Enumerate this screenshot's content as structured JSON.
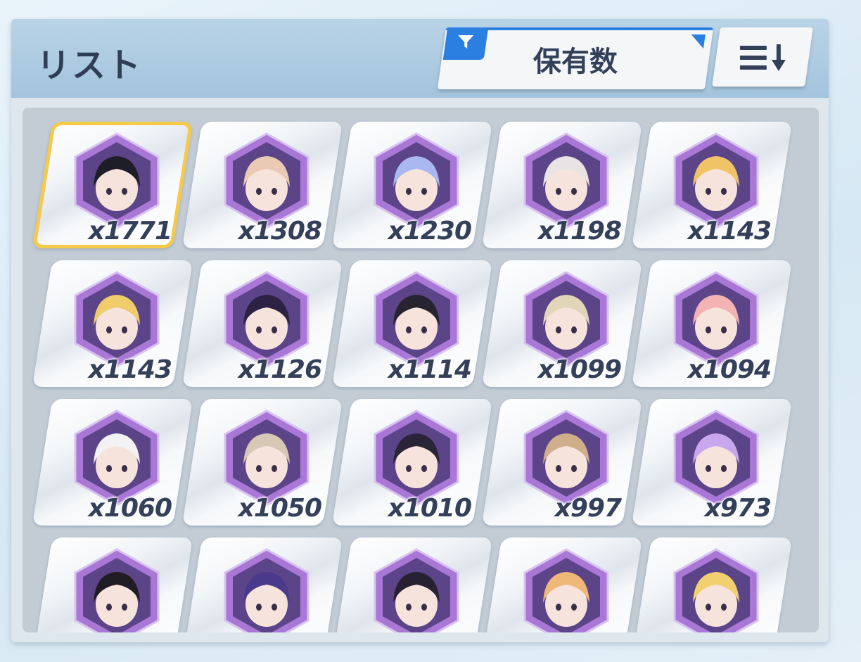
{
  "header": {
    "title": "リスト",
    "filter_label": "保有数",
    "filter_icon": "funnel-icon",
    "sort_icon": "sort-descending-icon"
  },
  "colors": {
    "accent": "#2a7fe0",
    "selected_border": "#f7c948",
    "hex_frame": "#a978d6"
  },
  "items": [
    {
      "count": "x1771",
      "hair": "#1e1e28",
      "selected": true
    },
    {
      "count": "x1308",
      "hair": "#e9cbb5"
    },
    {
      "count": "x1230",
      "hair": "#a9b8f0"
    },
    {
      "count": "x1198",
      "hair": "#e8e4e6"
    },
    {
      "count": "x1143",
      "hair": "#f0c466"
    },
    {
      "count": "x1143",
      "hair": "#f1cc6a"
    },
    {
      "count": "x1126",
      "hair": "#2c2244"
    },
    {
      "count": "x1114",
      "hair": "#262430"
    },
    {
      "count": "x1099",
      "hair": "#e2d6b8"
    },
    {
      "count": "x1094",
      "hair": "#f3b3b5"
    },
    {
      "count": "x1060",
      "hair": "#f2f2f4"
    },
    {
      "count": "x1050",
      "hair": "#d6c8b4"
    },
    {
      "count": "x1010",
      "hair": "#2a2438"
    },
    {
      "count": "x997",
      "hair": "#cfae8c"
    },
    {
      "count": "x973",
      "hair": "#c9a7ee"
    },
    {
      "count": "",
      "hair": "#1f1c24"
    },
    {
      "count": "",
      "hair": "#4a3a8c"
    },
    {
      "count": "",
      "hair": "#262232"
    },
    {
      "count": "",
      "hair": "#f0b878"
    },
    {
      "count": "",
      "hair": "#f2d070"
    }
  ]
}
